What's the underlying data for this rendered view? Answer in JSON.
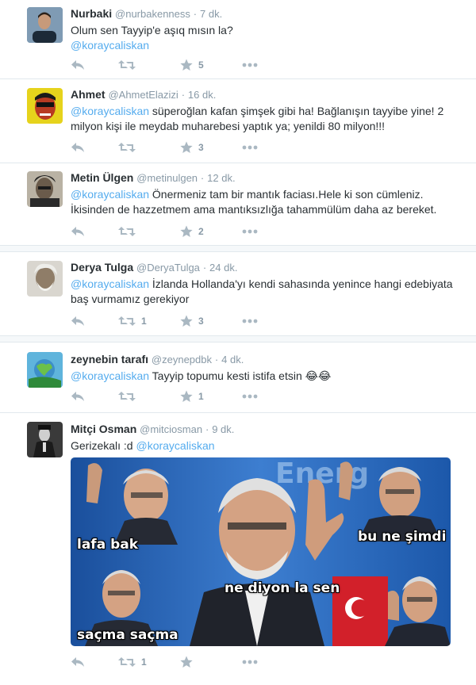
{
  "tweets": [
    {
      "name": "Nurbaki",
      "handle": "@nurbakenness",
      "dot": "·",
      "time": "7 dk.",
      "text": "Olum sen Tayyip'e aşıq mısın la?",
      "mention": "@koraycaliskan",
      "after": "",
      "retweets": "",
      "favorites": "5"
    },
    {
      "name": "Ahmet",
      "handle": "@AhmetElazizi",
      "dot": "·",
      "time": "16 dk.",
      "mention": "@koraycaliskan",
      "text": " süperoğlan kafan şimşek gibi ha! Bağlanışın tayyibe yine! 2 milyon kişi ile meydab muharebesi yaptık ya; yenildi 80 milyon!!!",
      "retweets": "",
      "favorites": "3"
    },
    {
      "name": "Metin Ülgen",
      "handle": "@metinulgen",
      "dot": "·",
      "time": "12 dk.",
      "mention": "@koraycaliskan",
      "text": " Önermeniz tam bir mantık faciası.Hele ki son cümleniz. İkisinden de hazzetmem ama mantıksızlığa tahammülüm daha az bereket.",
      "retweets": "",
      "favorites": "2"
    },
    {
      "name": "Derya Tulga",
      "handle": "@DeryaTulga",
      "dot": "·",
      "time": "24 dk.",
      "mention": "@koraycaliskan",
      "text": " İzlanda Hollanda'yı kendi sahasında yenince hangi edebiyata baş vurmamız gerekiyor",
      "retweets": "1",
      "favorites": "3"
    },
    {
      "name": "zeynebin tarafı",
      "handle": "@zeynepdbk",
      "dot": "·",
      "time": "4 dk.",
      "mention": "@koraycaliskan",
      "text": " Tayyip topumu kesti istifa etsin 😂😂",
      "retweets": "",
      "favorites": "1"
    },
    {
      "name": "Mitçi Osman",
      "handle": "@mitciosman",
      "dot": "·",
      "time": "9 dk.",
      "text": "Gerizekalı :d ",
      "mention": "@koraycaliskan",
      "retweets": "1",
      "favorites": ""
    }
  ],
  "meme": {
    "banner": "Energ",
    "captions": [
      "lafa bak",
      "bu ne şimdi",
      "ne diyon la sen",
      "saçma saçma"
    ]
  },
  "colors": {
    "accent": "#55acee",
    "icon": "#aab8c2",
    "border": "#e1e8ed"
  },
  "icons": [
    "reply-icon",
    "retweet-icon",
    "star-icon",
    "more-icon"
  ]
}
